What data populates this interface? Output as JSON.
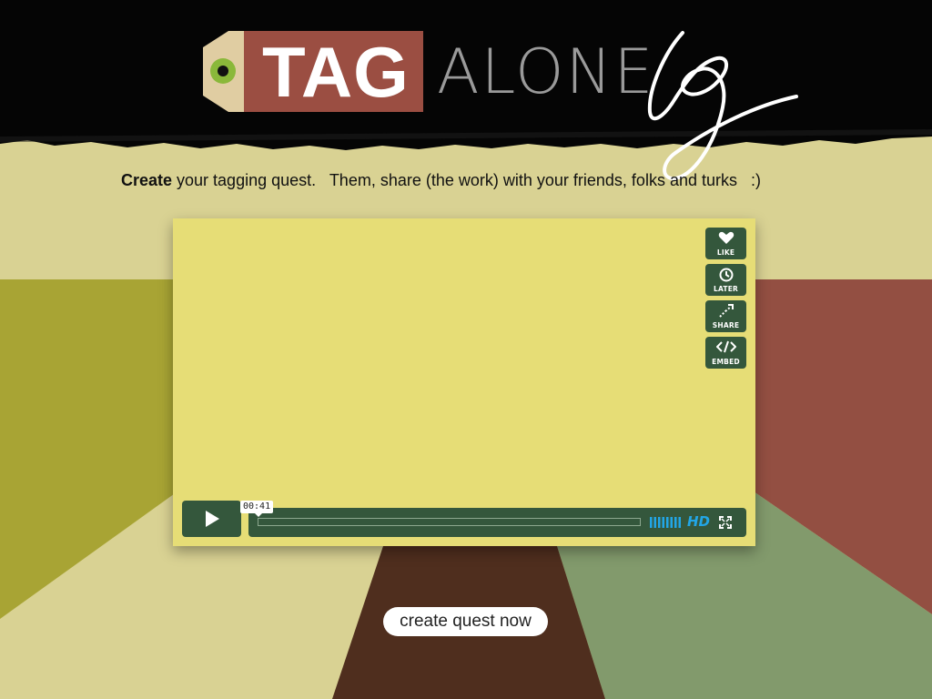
{
  "logo": {
    "tag_word": "TAG",
    "alone_word": "ALONE",
    "script_letter": "g"
  },
  "tagline": {
    "bold": "Create",
    "rest": " your tagging quest.   Them, share (the work) with your friends, folks and turks   :)"
  },
  "player": {
    "timecode": "00:41",
    "progress": 0,
    "side_buttons": {
      "like": "LIKE",
      "later": "LATER",
      "share": "SHARE",
      "embed": "EMBED"
    },
    "hd_label": "HD",
    "play_icon": "play-icon",
    "fullscreen_icon": "fullscreen-icon",
    "volume_icon": "volume-icon"
  },
  "cta": {
    "label": "create quest now"
  },
  "colors": {
    "olive": "#a8a434",
    "rust": "#934f42",
    "sage": "#829a6c",
    "brown": "#4f2e1e",
    "cream": "#d9d293",
    "player_bg": "#e6dd76",
    "control_green": "#34573c",
    "hd_blue": "#22a6e6",
    "tag_red": "#9b4e42",
    "tag_tan": "#e0cda2",
    "tag_dot": "#8ab83a"
  }
}
